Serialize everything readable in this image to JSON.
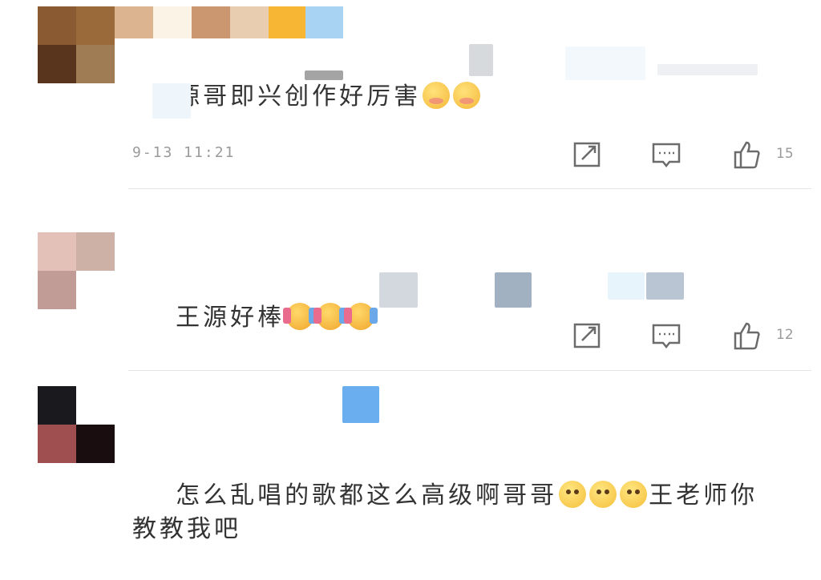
{
  "icons": {
    "share": "share-icon",
    "comment": "comment-icon",
    "like": "thumbs-up-icon"
  },
  "comments": [
    {
      "text": "源哥即兴创作好厉害",
      "emojis": [
        "shy",
        "shy"
      ],
      "timestamp": "9-13 11:21",
      "likes": "15",
      "avatar_colors": [
        "#8a5a32",
        "#9a6a3a",
        "#5a351d",
        "#a07c55"
      ]
    },
    {
      "text": "王源好棒",
      "emojis": [
        "cheer",
        "cheer",
        "cheer"
      ],
      "likes": "12",
      "avatar_colors": [
        "#e3c0b8",
        "#cdb0a6",
        "#c19b95",
        "#ffffff"
      ]
    },
    {
      "text_line1": "怎么乱唱的歌都这么高级啊哥哥",
      "emojis": [
        "sad",
        "sad",
        "sad"
      ],
      "text_line1_suffix": "王老师你",
      "text_line2": "教教我吧",
      "avatar_colors": [
        "#1a1a1e",
        "#ffffff",
        "#a04f50",
        "#1a0d10"
      ]
    }
  ],
  "colors": {
    "text": "#333333",
    "meta": "#9a9a9a",
    "divider": "#e6e6e6",
    "icon": "#6b6b6b"
  }
}
